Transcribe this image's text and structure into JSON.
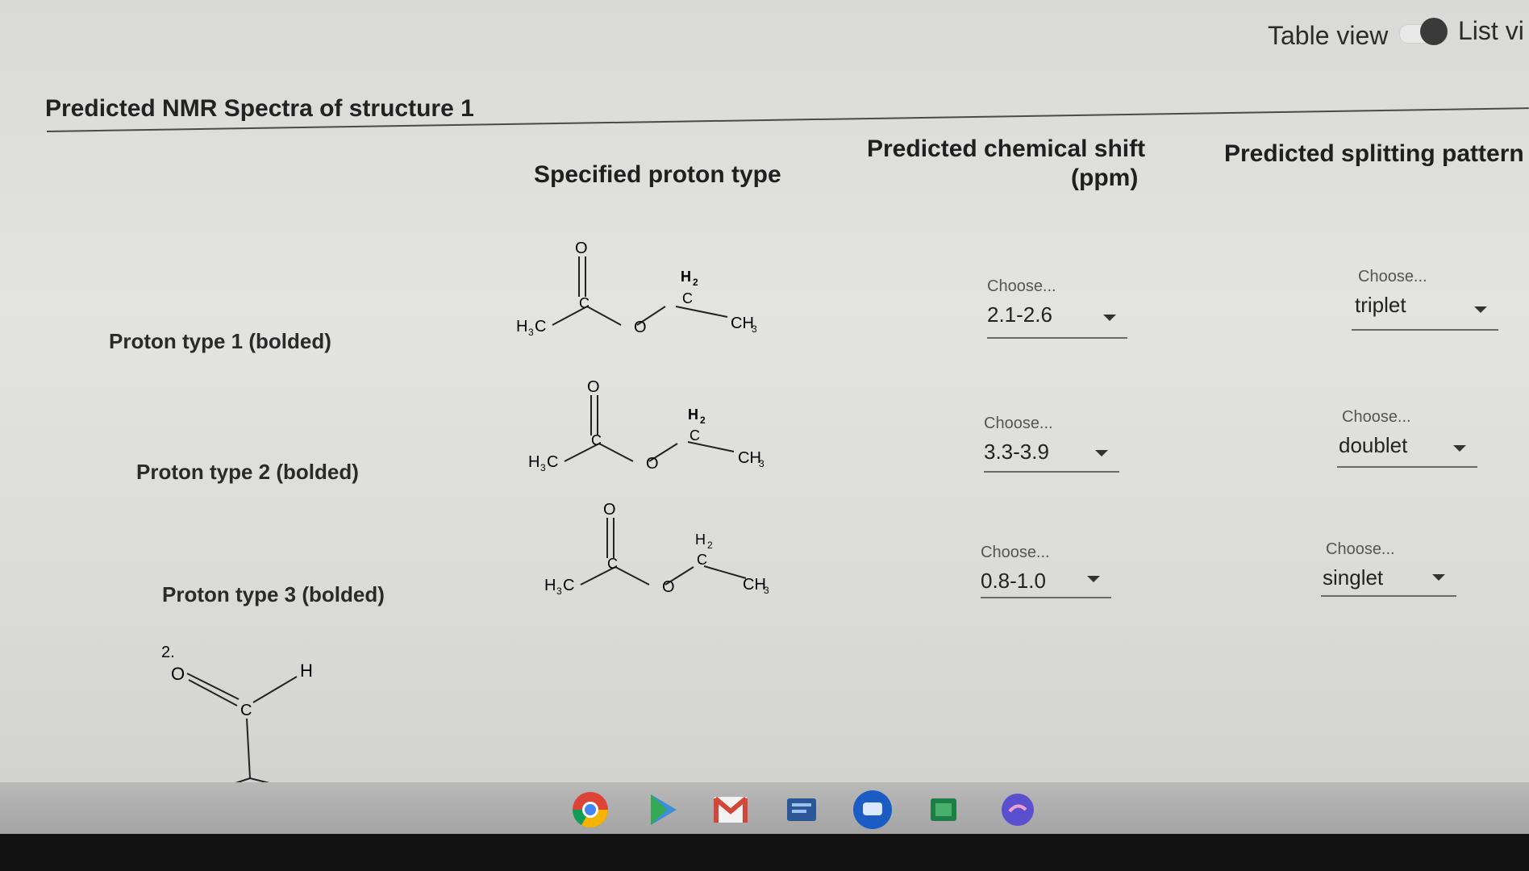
{
  "header": {
    "title": "Predicted NMR Spectra of structure 1",
    "table_view_label": "Table view",
    "list_view_label": "List vi"
  },
  "table": {
    "col_specified": "Specified proton type",
    "col_shift_line1": "Predicted chemical shift",
    "col_shift_line2": "(ppm)",
    "col_splitting": "Predicted splitting pattern",
    "rows": [
      {
        "label": "Proton type 1 (bolded)",
        "shift_placeholder": "Choose...",
        "shift_value": "2.1-2.6",
        "split_placeholder": "Choose...",
        "split_value": "triplet"
      },
      {
        "label": "Proton type 2 (bolded)",
        "shift_placeholder": "Choose...",
        "shift_value": "3.3-3.9",
        "split_placeholder": "Choose...",
        "split_value": "doublet"
      },
      {
        "label": "Proton type 3 (bolded)",
        "shift_placeholder": "Choose...",
        "shift_value": "0.8-1.0",
        "split_placeholder": "Choose...",
        "split_value": "singlet"
      }
    ]
  },
  "structure_labels": {
    "o": "O",
    "c": "C",
    "h2": "H",
    "h2_sub": "2",
    "h3c": "H",
    "h3c_sub": "3",
    "h3c_c": "C",
    "ch3": "CH",
    "ch3_sub": "3"
  },
  "next_question": {
    "number": "2.",
    "o": "O",
    "c": "C",
    "h": "H"
  },
  "taskbar": {
    "apps": [
      "chrome-icon",
      "play-store-icon",
      "gmail-icon",
      "docs-icon",
      "messages-icon",
      "sheets-icon",
      "app-icon"
    ]
  }
}
